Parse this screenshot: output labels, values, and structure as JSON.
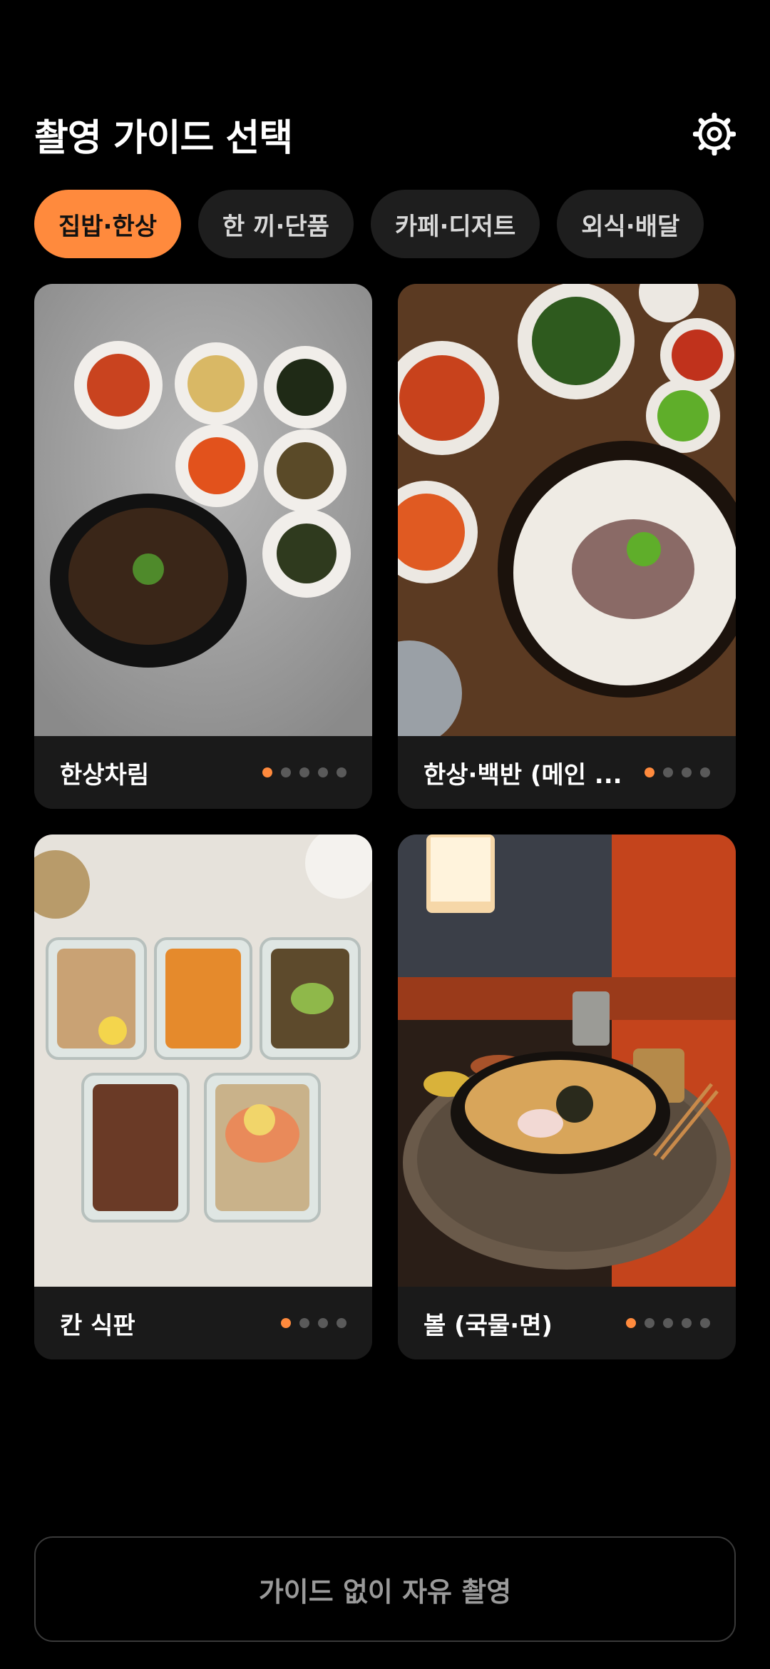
{
  "header": {
    "title": "촬영 가이드 선택",
    "settings_icon": "gear-icon"
  },
  "categories": [
    {
      "label": "집밥·한상",
      "active": true
    },
    {
      "label": "한 끼·단품",
      "active": false
    },
    {
      "label": "카페·디저트",
      "active": false
    },
    {
      "label": "외식·배달",
      "active": false
    }
  ],
  "cards": [
    {
      "label": "한상차림",
      "dots": 5,
      "active_dot": 0,
      "image": "korean-table-setting-photo"
    },
    {
      "label": "한상·백반 (메인 ...",
      "dots": 4,
      "active_dot": 0,
      "image": "gukbap-banchan-photo"
    },
    {
      "label": "칸 식판",
      "dots": 4,
      "active_dot": 0,
      "image": "meal-prep-containers-photo"
    },
    {
      "label": "볼 (국물·면)",
      "dots": 5,
      "active_dot": 0,
      "image": "ramen-bowl-photo"
    }
  ],
  "footer": {
    "free_shoot_label": "가이드 없이 자유 촬영"
  },
  "colors": {
    "accent": "#ff8a3d",
    "background": "#000000",
    "card": "#1a1a1a",
    "chip": "#1e1e1e"
  }
}
